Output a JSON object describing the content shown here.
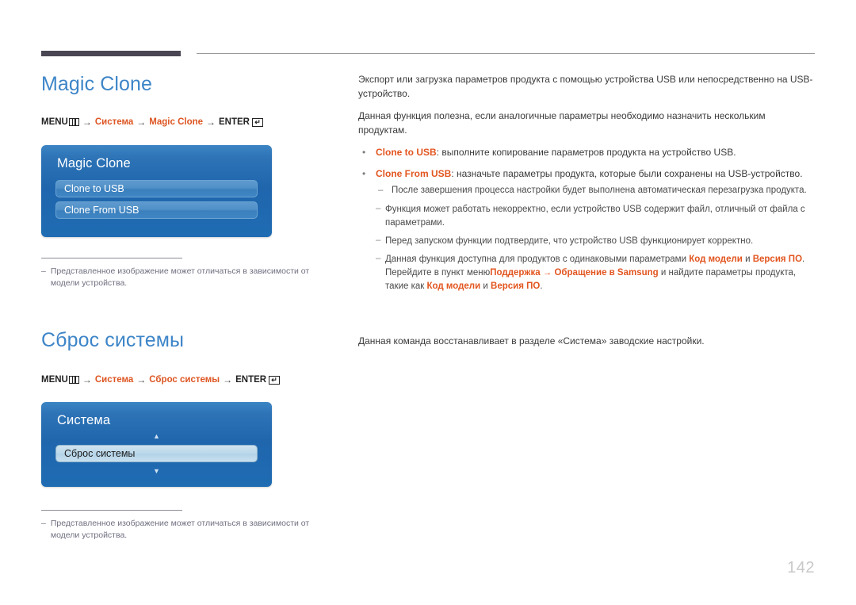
{
  "page": {
    "number": "142"
  },
  "sections": [
    {
      "heading": "Magic Clone",
      "menu_path": {
        "menu_label": "MENU",
        "menu_icon": "menu-bars-icon",
        "arrow": "→",
        "step1": "Система",
        "step2": "Magic Clone",
        "enter_label": "ENTER",
        "enter_icon": "enter-return-icon",
        "enter_glyph": "↵"
      },
      "osd": {
        "title": "Magic Clone",
        "rows": [
          {
            "label": "Clone to USB",
            "state": "plain"
          },
          {
            "label": "Clone From USB",
            "state": "plain"
          }
        ],
        "has_up_arrow": false,
        "has_down_arrow": false
      },
      "footnote": {
        "dash": "–",
        "text": "Представленное изображение может отличаться в зависимости от модели устройства."
      },
      "body": {
        "paragraphs": [
          "Экспорт или загрузка параметров продукта с помощью устройства USB или непосредственно на USB-устройство.",
          "Данная функция полезна, если аналогичные параметры необходимо назначить нескольким продуктам."
        ],
        "bullets": [
          {
            "mark": "•",
            "term": "Clone to USB",
            "rest": ": выполните копирование параметров продукта на устройство USB."
          },
          {
            "mark": "•",
            "term": "Clone From USB",
            "rest": ": назначьте параметры продукта, которые были сохранены на USB-устройство."
          }
        ],
        "sub_items": [
          {
            "mark": "–",
            "text": "После завершения процесса настройки будет выполнена автоматическая перезагрузка продукта."
          }
        ],
        "notes": [
          {
            "mark": "–",
            "text": "Функция может работать некорректно, если устройство USB содержит файл, отличный от файла с параметрами."
          },
          {
            "mark": "–",
            "text": "Перед запуском функции подтвердите, что устройство USB функционирует корректно."
          }
        ],
        "rich_note": {
          "mark": "–",
          "part1": "Данная функция доступна для продуктов с одинаковыми параметрами ",
          "bold1": "Код модели",
          "part2": " и ",
          "bold2": "Версия ПО",
          "part3": ". Перейдите в пункт меню",
          "bold3": "Поддержка",
          "arrow": " → ",
          "bold4": "Обращение в Samsung",
          "part4": " и найдите параметры продукта, такие как ",
          "bold5": "Код модели",
          "part5": " и ",
          "bold6": "Версия ПО",
          "part6": "."
        }
      }
    },
    {
      "heading": "Сброс системы",
      "menu_path": {
        "menu_label": "MENU",
        "menu_icon": "menu-bars-icon",
        "arrow": "→",
        "step1": "Система",
        "step2": "Сброс системы",
        "enter_label": "ENTER",
        "enter_icon": "enter-return-icon",
        "enter_glyph": "↵"
      },
      "osd": {
        "title": "Система",
        "rows": [
          {
            "label": "Сброс системы",
            "state": "selected"
          }
        ],
        "has_up_arrow": true,
        "has_down_arrow": true,
        "up_glyph": "▲",
        "down_glyph": "▼"
      },
      "footnote": {
        "dash": "–",
        "text": "Представленное изображение может отличаться в зависимости от модели устройства."
      },
      "body": {
        "paragraphs": [
          "Данная команда восстанавливает в разделе «Система» заводские настройки."
        ]
      }
    }
  ],
  "colors": {
    "heading": "#3d85c8",
    "accent": "#dd5522",
    "rule_dark": "#4a4653",
    "rule_light": "#9a9a9a",
    "panel_blue": "#1f66ad",
    "page_number": "#c8c8c8"
  }
}
